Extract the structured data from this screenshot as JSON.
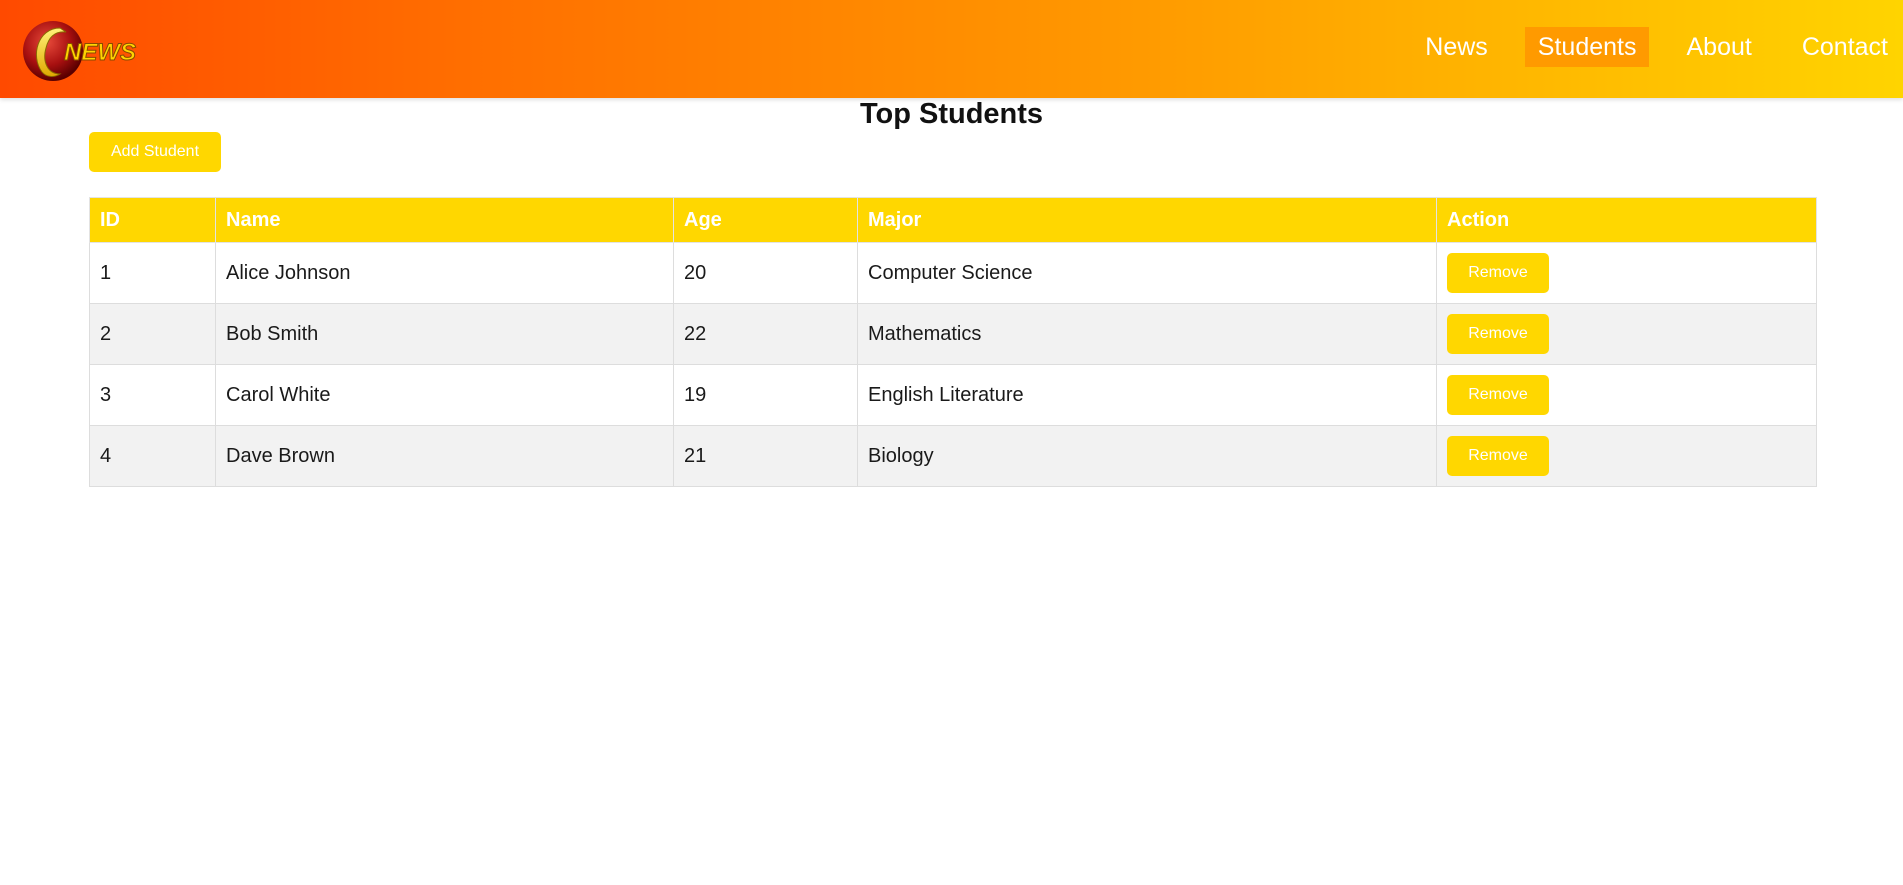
{
  "header": {
    "logo_text": "NEWS",
    "nav": [
      {
        "label": "News",
        "active": false
      },
      {
        "label": "Students",
        "active": true
      },
      {
        "label": "About",
        "active": false
      },
      {
        "label": "Contact",
        "active": false
      }
    ]
  },
  "main": {
    "title": "Top Students",
    "add_button_label": "Add Student",
    "table": {
      "headers": [
        "ID",
        "Name",
        "Age",
        "Major",
        "Action"
      ],
      "rows": [
        {
          "id": "1",
          "name": "Alice Johnson",
          "age": "20",
          "major": "Computer Science",
          "action": "Remove"
        },
        {
          "id": "2",
          "name": "Bob Smith",
          "age": "22",
          "major": "Mathematics",
          "action": "Remove"
        },
        {
          "id": "3",
          "name": "Carol White",
          "age": "19",
          "major": "English Literature",
          "action": "Remove"
        },
        {
          "id": "4",
          "name": "Dave Brown",
          "age": "21",
          "major": "Biology",
          "action": "Remove"
        }
      ]
    }
  },
  "colors": {
    "accent": "#ffd700",
    "header_gradient_start": "#ff4a00",
    "header_gradient_end": "#ffd400",
    "active_nav": "#ff9a00",
    "row_alt": "#f2f2f2"
  },
  "icons": {
    "logo": "news-logo-icon"
  }
}
